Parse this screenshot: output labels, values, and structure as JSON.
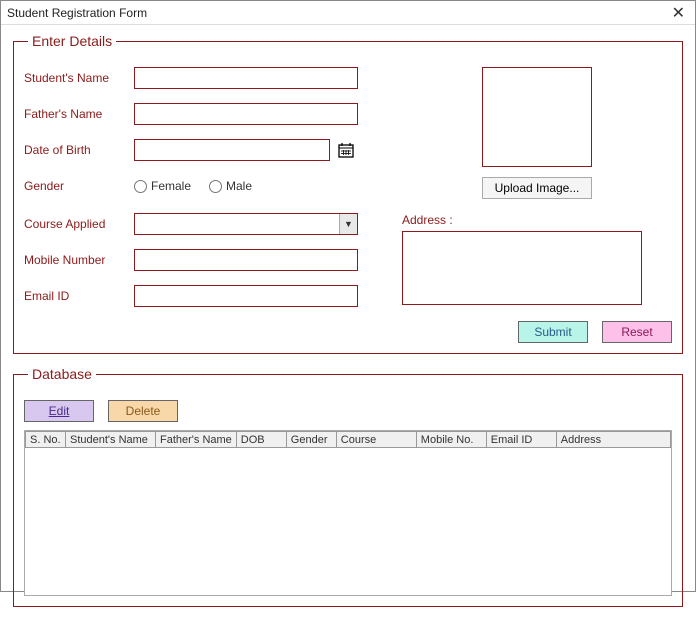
{
  "window": {
    "title": "Student Registration Form"
  },
  "enter": {
    "legend": "Enter Details",
    "labels": {
      "name": "Student's Name",
      "father": "Father's Name",
      "dob": "Date of Birth",
      "gender": "Gender",
      "course": "Course Applied",
      "mobile": "Mobile Number",
      "email": "Email ID",
      "address": "Address :"
    },
    "values": {
      "name": "",
      "father": "",
      "dob": "",
      "course": "",
      "mobile": "",
      "email": "",
      "address": ""
    },
    "gender_options": {
      "female": "Female",
      "male": "Male"
    },
    "upload_label": "Upload Image...",
    "buttons": {
      "submit": "Submit",
      "reset": "Reset"
    }
  },
  "database": {
    "legend": "Database",
    "buttons": {
      "edit": "Edit",
      "delete": "Delete"
    },
    "columns": [
      "S. No.",
      "Student's Name",
      "Father's Name",
      "DOB",
      "Gender",
      "Course",
      "Mobile No.",
      "Email ID",
      "Address"
    ],
    "rows": []
  }
}
